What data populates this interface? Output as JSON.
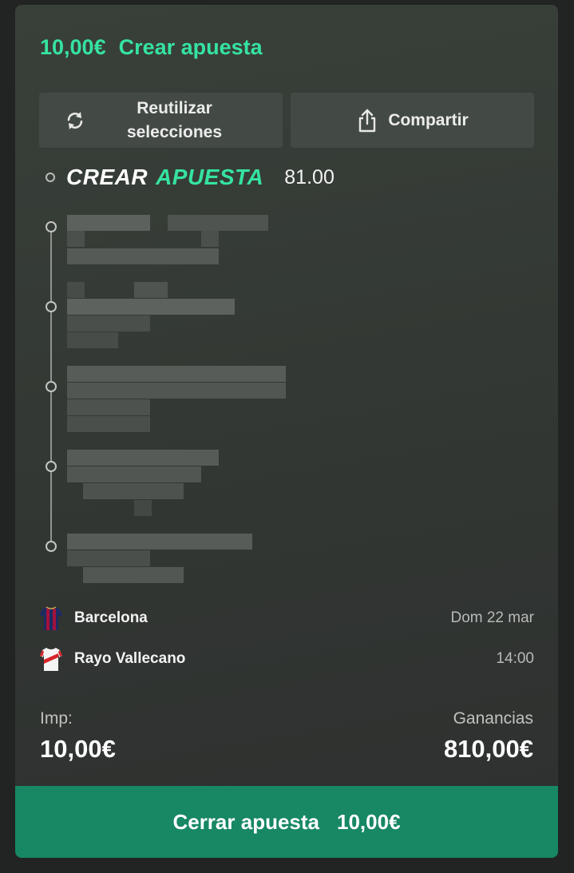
{
  "header": {
    "amount": "10,00€",
    "title": "Crear apuesta"
  },
  "actions": {
    "reuse_label": "Reutilizar selecciones",
    "reuse_icon": "refresh-icon",
    "share_label": "Compartir",
    "share_icon": "share-icon"
  },
  "builder": {
    "brand_part1": "CREAR",
    "brand_part2": "APUESTA",
    "odds": "81.00",
    "selections_count": 5
  },
  "match": {
    "home_team": "Barcelona",
    "away_team": "Rayo Vallecano",
    "date": "Dom 22 mar",
    "time": "14:00"
  },
  "summary": {
    "stake_label": "Imp:",
    "stake_value": "10,00€",
    "winnings_label": "Ganancias",
    "winnings_value": "810,00€"
  },
  "cta": {
    "label": "Cerrar apuesta",
    "amount": "10,00€"
  },
  "colors": {
    "accent": "#35e3a0",
    "cta_bg": "#178764",
    "card_bg": "#353a36"
  }
}
